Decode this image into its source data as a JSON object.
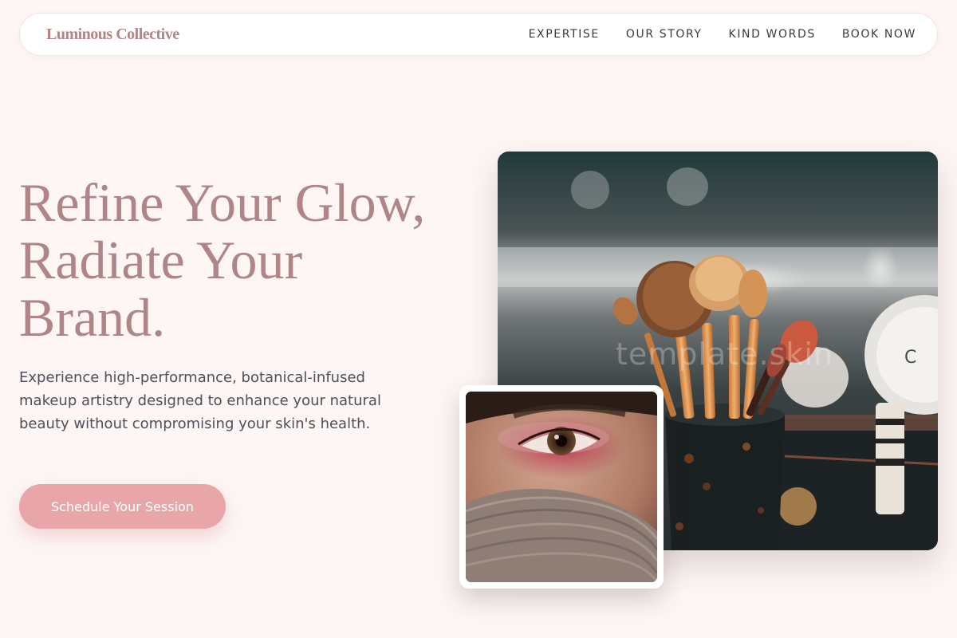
{
  "nav": {
    "brand": "Luminous Collective",
    "links": [
      "EXPERTISE",
      "OUR STORY",
      "KIND WORDS",
      "BOOK NOW"
    ]
  },
  "hero": {
    "title_lines": [
      "Refine Your Glow,",
      "Radiate Your",
      "Brand."
    ],
    "description": "Experience high-performance, botanical-infused makeup artistry designed to enhance your natural beauty without compromising your skin's health.",
    "cta_label": "Schedule Your Session"
  },
  "images": {
    "main_watermark": "template.skin"
  },
  "colors": {
    "background": "#fdf6f5",
    "brand": "#b38488",
    "heading": "#b08589",
    "cta": "#e8a6a8",
    "nav_text": "#3a3a3a",
    "body_text": "#4e4f57"
  }
}
